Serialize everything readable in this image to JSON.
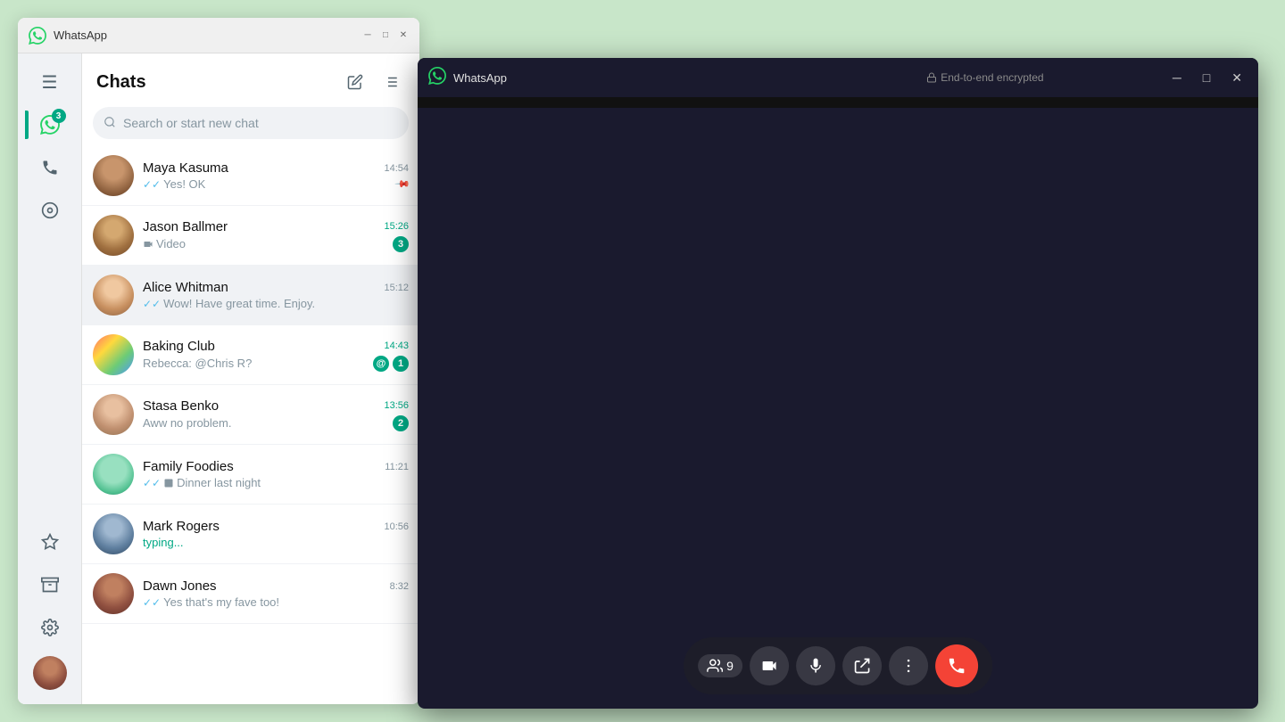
{
  "app": {
    "title": "WhatsApp",
    "e2e_label": "End-to-end encrypted",
    "lock_icon": "🔒"
  },
  "sidebar": {
    "chat_badge": "3",
    "items": [
      {
        "label": "Menu",
        "icon": "☰",
        "name": "menu"
      },
      {
        "label": "Chats",
        "icon": "💬",
        "name": "chats",
        "active": true,
        "badge": "3"
      },
      {
        "label": "Calls",
        "icon": "📞",
        "name": "calls"
      },
      {
        "label": "Status",
        "icon": "⊙",
        "name": "status"
      }
    ]
  },
  "chats_panel": {
    "title": "Chats",
    "new_chat_icon": "✏️",
    "filter_icon": "☰",
    "search_placeholder": "Search or start new chat"
  },
  "chat_list": [
    {
      "name": "Maya Kasuma",
      "time": "14:54",
      "time_color": "gray",
      "preview": "Yes! OK",
      "check": "double",
      "has_pin": true,
      "avatar_class": "avatar-maya"
    },
    {
      "name": "Jason Ballmer",
      "time": "15:26",
      "time_color": "green",
      "preview": "🎥 Video",
      "unread": "3",
      "avatar_class": "avatar-jason"
    },
    {
      "name": "Alice Whitman",
      "time": "15:12",
      "time_color": "gray",
      "preview": "Wow! Have great time. Enjoy.",
      "check": "double",
      "active": true,
      "avatar_class": "avatar-alice"
    },
    {
      "name": "Baking Club",
      "time": "14:43",
      "time_color": "green",
      "preview": "Rebecca: @Chris R?",
      "mention": true,
      "unread": "1",
      "avatar_class": "avatar-baking"
    },
    {
      "name": "Stasa Benko",
      "time": "13:56",
      "time_color": "green",
      "preview": "Aww no problem.",
      "unread": "2",
      "avatar_class": "avatar-stasa"
    },
    {
      "name": "Family Foodies",
      "time": "11:21",
      "time_color": "gray",
      "preview": "Dinner last night",
      "check": "double",
      "has_image": true,
      "avatar_class": "avatar-family"
    },
    {
      "name": "Mark Rogers",
      "time": "10:56",
      "time_color": "gray",
      "preview": "typing...",
      "is_typing": true,
      "avatar_class": "avatar-mark"
    },
    {
      "name": "Dawn Jones",
      "time": "8:32",
      "time_color": "gray",
      "preview": "Yes that's my fave too!",
      "check": "double",
      "avatar_class": "avatar-dawn"
    }
  ],
  "call": {
    "participants_count": "9",
    "controls": {
      "participants_label": "9",
      "video_icon": "📹",
      "mic_icon": "🎤",
      "share_icon": "📤",
      "more_icon": "•••",
      "end_icon": "📵"
    }
  },
  "video_cells": [
    {
      "id": 1,
      "muted": true,
      "highlighted": false,
      "bg_class": "vp1"
    },
    {
      "id": 2,
      "muted": false,
      "highlighted": false,
      "bg_class": "vp2"
    },
    {
      "id": 3,
      "muted": false,
      "highlighted": false,
      "bg_class": "vp3"
    },
    {
      "id": 4,
      "muted": true,
      "highlighted": false,
      "bg_class": "vp4"
    },
    {
      "id": 5,
      "muted": false,
      "highlighted": true,
      "bg_class": "vp5"
    },
    {
      "id": 6,
      "muted": false,
      "highlighted": false,
      "bg_class": "vp6"
    },
    {
      "id": 7,
      "muted": false,
      "highlighted": false,
      "bg_class": "vp7"
    },
    {
      "id": 8,
      "muted": false,
      "highlighted": false,
      "bg_class": "vp8"
    },
    {
      "id": 9,
      "muted": false,
      "highlighted": false,
      "bg_class": "vp9"
    }
  ]
}
